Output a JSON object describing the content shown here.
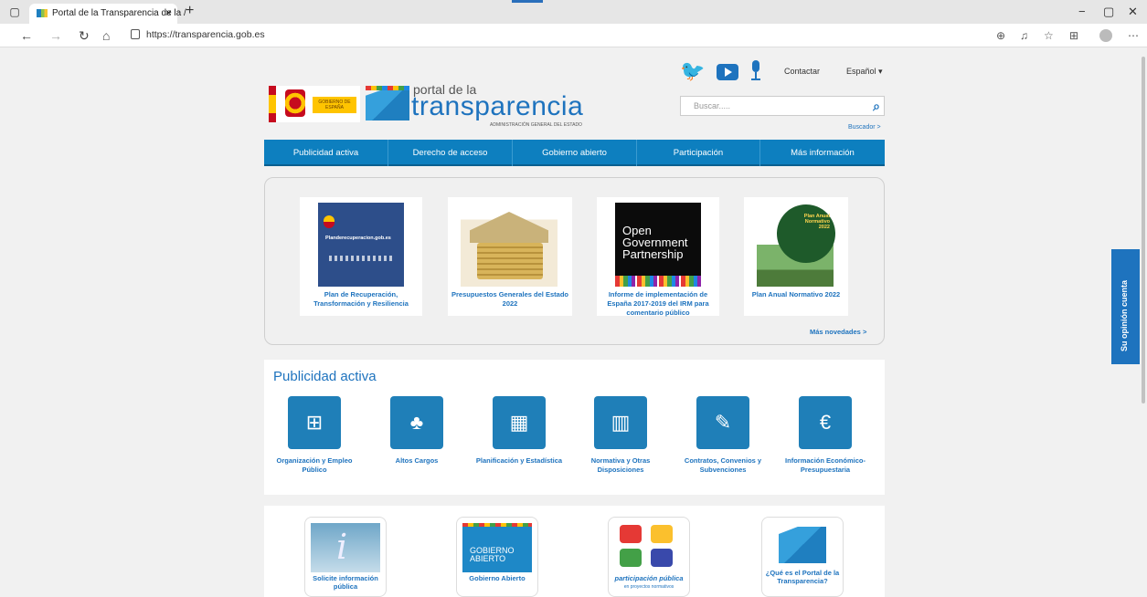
{
  "browser": {
    "tab_title": "Portal de la Transparencia de la /",
    "tab_close": "×",
    "new_tab": "+",
    "url": "https://transparencia.gob.es",
    "window_controls": [
      "−",
      "▢",
      "✕"
    ]
  },
  "header": {
    "contactar": "Contactar",
    "language": "Español",
    "logo_line1": "portal de la",
    "logo_line2": "transparencia",
    "logo_subtitle": "ADMINISTRACIÓN GENERAL DEL ESTADO",
    "gobierno_label": "GOBIERNO DE ESPAÑA",
    "search_placeholder": "Buscar.....",
    "buscador_link": "Buscador >"
  },
  "menu": {
    "items": [
      "Publicidad activa",
      "Derecho de acceso",
      "Gobierno abierto",
      "Participación",
      "Más información"
    ]
  },
  "novedades": {
    "items": [
      {
        "caption": "Plan de Recuperación, Transformación y Resiliencia",
        "img_text": "Planderecuperacion.gob.es"
      },
      {
        "caption": "Presupuestos Generales del Estado 2022"
      },
      {
        "caption": "Informe de implementación de España 2017-2019 del IRM para comentario público",
        "img_text": "Open Government Partnership"
      },
      {
        "caption": "Plan Anual Normativo 2022",
        "img_text": "Plan Anual Normativo 2022"
      }
    ],
    "more_link": "Más novedades >"
  },
  "publicidad": {
    "title": "Publicidad activa",
    "items": [
      {
        "label": "Organización y Empleo Público",
        "icon": "org-chart-icon"
      },
      {
        "label": "Altos Cargos",
        "icon": "hierarchy-icon"
      },
      {
        "label": "Planificación y Estadística",
        "icon": "calendar-icon"
      },
      {
        "label": "Normativa y Otras Disposiciones",
        "icon": "books-icon"
      },
      {
        "label": "Contratos, Convenios y Subvenciones",
        "icon": "document-edit-icon"
      },
      {
        "label": "Información Económico-Presupuestaria",
        "icon": "money-icon"
      }
    ]
  },
  "bottom_cards": [
    {
      "caption": "Solicite información pública"
    },
    {
      "caption": "Gobierno Abierto",
      "img_text": "GOBIERNO ABIERTO"
    },
    {
      "caption": "participación pública",
      "sub": "en proyectos normativos"
    },
    {
      "caption": "¿Qué es el Portal de la Transparencia?"
    }
  ],
  "feedback": {
    "label": "Su opinión cuenta"
  }
}
